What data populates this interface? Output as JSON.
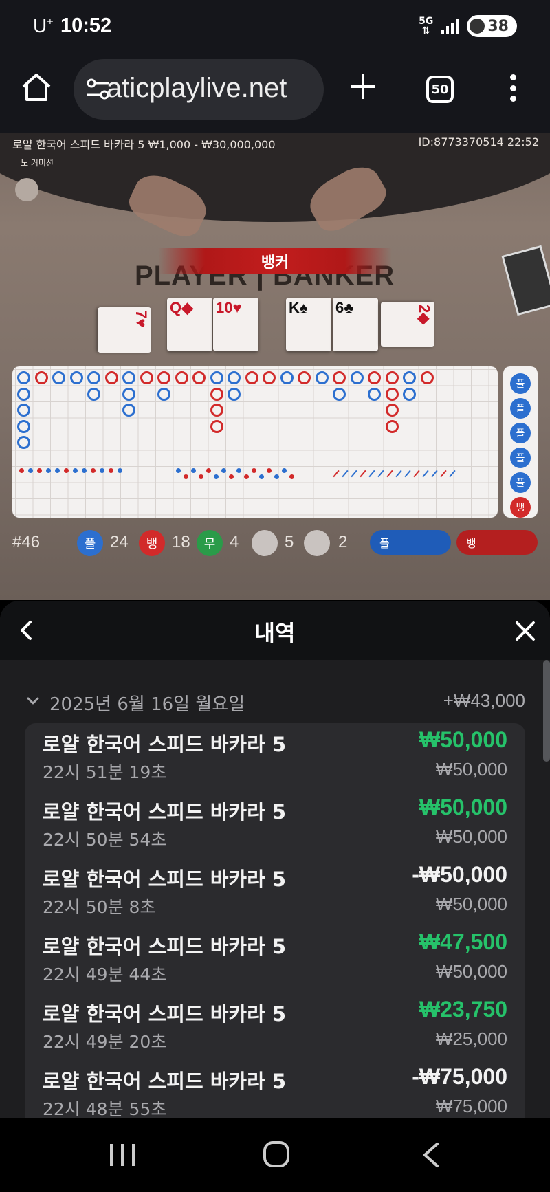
{
  "status_bar": {
    "carrier": "U",
    "carrier_sup": "+",
    "time": "10:52",
    "network": "5G",
    "battery": "38"
  },
  "browser": {
    "url": "aticplaylive.net",
    "tab_count": "50",
    "icons": [
      "home-icon",
      "site-settings-icon",
      "plus-icon",
      "tabs-icon",
      "more-vert-icon"
    ]
  },
  "game": {
    "table_info": "로얄 한국어 스피드 바카라 5   ₩1,000 - ₩30,000,000",
    "id_time": "ID:8773370514   22:52",
    "no_commission": "노 커미션",
    "result_banner": "뱅커",
    "pb_label": "PLAYER | BANKER",
    "player_cards": [
      "7",
      "Q",
      "10"
    ],
    "banker_cards": [
      "K",
      "6",
      "2"
    ],
    "side_road": [
      "플",
      "플",
      "플",
      "플",
      "플",
      "뱅"
    ],
    "stats": {
      "round": "#46",
      "player_label": "플",
      "player_count": "24",
      "banker_label": "뱅",
      "banker_count": "18",
      "tie_label": "무",
      "tie_count": "4",
      "p_pair_count": "5",
      "b_pair_count": "2",
      "predict_player": "플",
      "predict_banker": "뱅"
    }
  },
  "history": {
    "title": "내역",
    "date": "2025년 6월 16일 월요일",
    "date_total": "+₩43,000",
    "items": [
      {
        "game": "로얄 한국어 스피드 바카라 5",
        "time": "22시 51분 19초",
        "result": "₩50,000",
        "bet": "₩50,000",
        "state": "win"
      },
      {
        "game": "로얄 한국어 스피드 바카라 5",
        "time": "22시 50분 54초",
        "result": "₩50,000",
        "bet": "₩50,000",
        "state": "win"
      },
      {
        "game": "로얄 한국어 스피드 바카라 5",
        "time": "22시 50분 8초",
        "result": "-₩50,000",
        "bet": "₩50,000",
        "state": "lose"
      },
      {
        "game": "로얄 한국어 스피드 바카라 5",
        "time": "22시 49분 44초",
        "result": "₩47,500",
        "bet": "₩50,000",
        "state": "win"
      },
      {
        "game": "로얄 한국어 스피드 바카라 5",
        "time": "22시 49분 20초",
        "result": "₩23,750",
        "bet": "₩25,000",
        "state": "win"
      },
      {
        "game": "로얄 한국어 스피드 바카라 5",
        "time": "22시 48분 55초",
        "result": "-₩75,000",
        "bet": "₩75,000",
        "state": "lose"
      }
    ]
  },
  "colors": {
    "win": "#26c26a",
    "player_blue": "#2c6fcf",
    "banker_red": "#d22a2a",
    "sheet_bg": "#1e1e20",
    "list_bg": "#2b2b2e"
  },
  "nav": {
    "icons": [
      "recents-icon",
      "home-nav-icon",
      "back-nav-icon"
    ]
  }
}
